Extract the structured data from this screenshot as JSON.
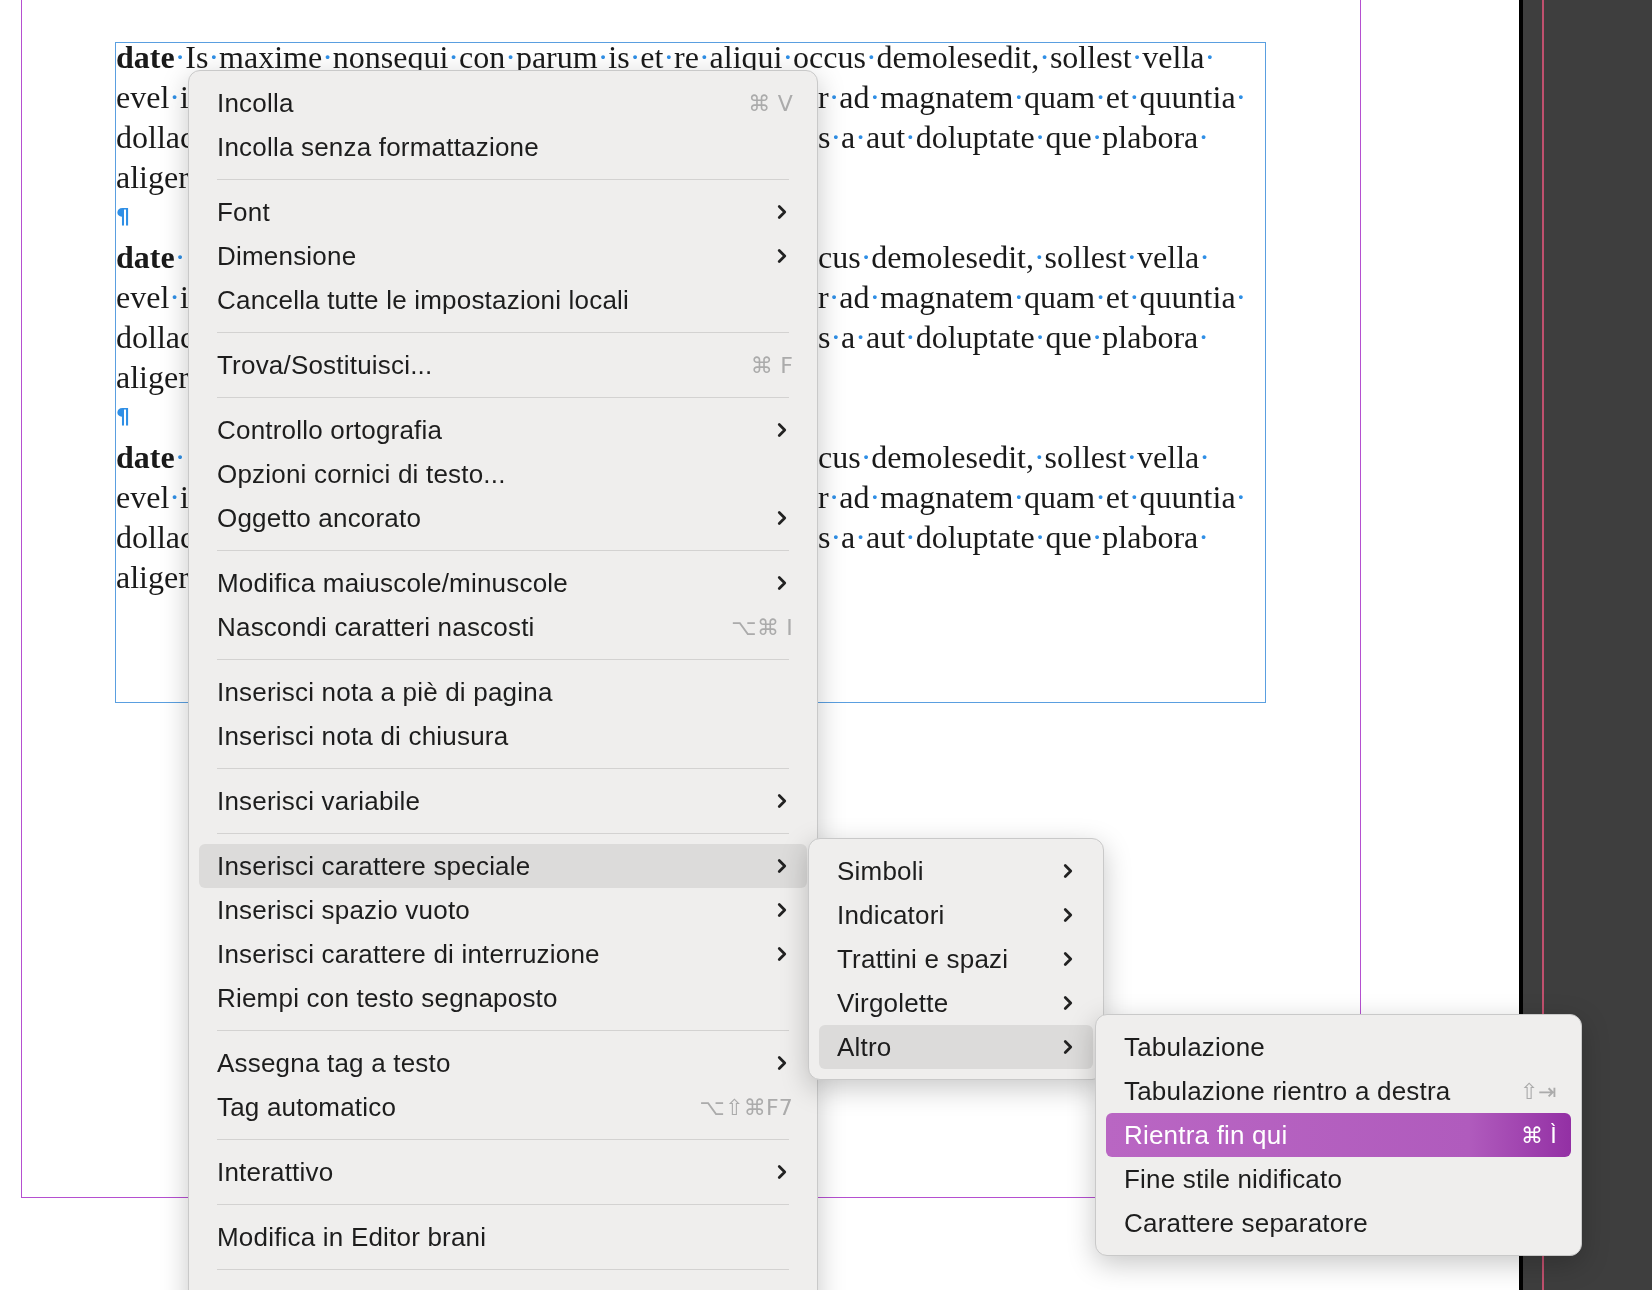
{
  "document": {
    "paragraphs": [
      {
        "lines": [
          {
            "text": "**date**·Is·maxime·nonsequi·con·parum·is·et·re·aliqui·occus·demolesedit,·sollest·vella·"
          },
          {
            "left": "evel·i",
            "right": "r·ad·magnatem·quam·et·quuntia·"
          },
          {
            "left": "dollac",
            "right": "s·a·aut·doluptate·que·plabora·"
          },
          {
            "left": "aliger"
          }
        ],
        "end_mark": "¶"
      },
      {
        "lines": [
          {
            "left": "**date**·",
            "right": "cus·demolesedit,·sollest·vella·"
          },
          {
            "left": "evel·i",
            "right": "r·ad·magnatem·quam·et·quuntia·"
          },
          {
            "left": "dollac",
            "right": "s·a·aut·doluptate·que·plabora·"
          },
          {
            "left": "aliger"
          }
        ],
        "end_mark": "¶"
      },
      {
        "lines": [
          {
            "left": "**date**·",
            "right": "cus·demolesedit,·sollest·vella·"
          },
          {
            "left": "evel·i",
            "right": "r·ad·magnatem·quam·et·quuntia·"
          },
          {
            "left": "dollac",
            "right": "s·a·aut·doluptate·que·plabora·"
          },
          {
            "left": "aliger"
          }
        ]
      }
    ]
  },
  "context_menu": {
    "items": [
      {
        "kind": "item",
        "label": "Incolla",
        "shortcut": "⌘ V",
        "has_submenu": false,
        "selected": false,
        "expanded": false
      },
      {
        "kind": "item",
        "label": "Incolla senza formattazione",
        "has_submenu": false,
        "selected": false,
        "expanded": false
      },
      {
        "kind": "separator"
      },
      {
        "kind": "item",
        "label": "Font",
        "has_submenu": true,
        "selected": false,
        "expanded": false
      },
      {
        "kind": "item",
        "label": "Dimensione",
        "has_submenu": true,
        "selected": false,
        "expanded": false
      },
      {
        "kind": "item",
        "label": "Cancella tutte le impostazioni locali",
        "has_submenu": false,
        "selected": false,
        "expanded": false
      },
      {
        "kind": "separator"
      },
      {
        "kind": "item",
        "label": "Trova/Sostituisci...",
        "shortcut": "⌘ F",
        "has_submenu": false,
        "selected": false,
        "expanded": false
      },
      {
        "kind": "separator"
      },
      {
        "kind": "item",
        "label": "Controllo ortografia",
        "has_submenu": true,
        "selected": false,
        "expanded": false
      },
      {
        "kind": "item",
        "label": "Opzioni cornici di testo...",
        "has_submenu": false,
        "selected": false,
        "expanded": false
      },
      {
        "kind": "item",
        "label": "Oggetto ancorato",
        "has_submenu": true,
        "selected": false,
        "expanded": false
      },
      {
        "kind": "separator"
      },
      {
        "kind": "item",
        "label": "Modifica maiuscole/minuscole",
        "has_submenu": true,
        "selected": false,
        "expanded": false
      },
      {
        "kind": "item",
        "label": "Nascondi caratteri nascosti",
        "shortcut": "⌥⌘ I",
        "has_submenu": false,
        "selected": false,
        "expanded": false
      },
      {
        "kind": "separator"
      },
      {
        "kind": "item",
        "label": "Inserisci nota a piè di pagina",
        "has_submenu": false,
        "selected": false,
        "expanded": false
      },
      {
        "kind": "item",
        "label": "Inserisci nota di chiusura",
        "has_submenu": false,
        "selected": false,
        "expanded": false
      },
      {
        "kind": "separator"
      },
      {
        "kind": "item",
        "label": "Inserisci variabile",
        "has_submenu": true,
        "selected": false,
        "expanded": false
      },
      {
        "kind": "separator"
      },
      {
        "kind": "item",
        "label": "Inserisci carattere speciale",
        "has_submenu": true,
        "selected": false,
        "expanded": true
      },
      {
        "kind": "item",
        "label": "Inserisci spazio vuoto",
        "has_submenu": true,
        "selected": false,
        "expanded": false
      },
      {
        "kind": "item",
        "label": "Inserisci carattere di interruzione",
        "has_submenu": true,
        "selected": false,
        "expanded": false
      },
      {
        "kind": "item",
        "label": "Riempi con testo segnaposto",
        "has_submenu": false,
        "selected": false,
        "expanded": false
      },
      {
        "kind": "separator"
      },
      {
        "kind": "item",
        "label": "Assegna tag a testo",
        "has_submenu": true,
        "selected": false,
        "expanded": false
      },
      {
        "kind": "item",
        "label": "Tag automatico",
        "shortcut": "⌥⇧⌘F7",
        "has_submenu": false,
        "selected": false,
        "expanded": false
      },
      {
        "kind": "separator"
      },
      {
        "kind": "item",
        "label": "Interattivo",
        "has_submenu": true,
        "selected": false,
        "expanded": false
      },
      {
        "kind": "separator"
      },
      {
        "kind": "item",
        "label": "Modifica in Editor brani",
        "has_submenu": false,
        "selected": false,
        "expanded": false
      },
      {
        "kind": "separator"
      }
    ]
  },
  "submenu": {
    "items": [
      {
        "kind": "item",
        "label": "Simboli",
        "has_submenu": true,
        "selected": false,
        "expanded": false
      },
      {
        "kind": "item",
        "label": "Indicatori",
        "has_submenu": true,
        "selected": false,
        "expanded": false
      },
      {
        "kind": "item",
        "label": "Trattini e spazi",
        "has_submenu": true,
        "selected": false,
        "expanded": false
      },
      {
        "kind": "item",
        "label": "Virgolette",
        "has_submenu": true,
        "selected": false,
        "expanded": false
      },
      {
        "kind": "item",
        "label": "Altro",
        "has_submenu": true,
        "selected": false,
        "expanded": true
      }
    ]
  },
  "submenu_2": {
    "items": [
      {
        "kind": "item",
        "label": "Tabulazione",
        "has_submenu": false,
        "selected": false,
        "expanded": false
      },
      {
        "kind": "item",
        "label": "Tabulazione rientro a destra",
        "shortcut": "⇧⇥",
        "has_submenu": false,
        "selected": false,
        "expanded": false
      },
      {
        "kind": "item",
        "label": "Rientra fin qui",
        "shortcut": "⌘ Ì",
        "has_submenu": false,
        "selected": true,
        "expanded": false
      },
      {
        "kind": "item",
        "label": "Fine stile nidificato",
        "has_submenu": false,
        "selected": false,
        "expanded": false
      },
      {
        "kind": "item",
        "label": "Carattere separatore",
        "has_submenu": false,
        "selected": false,
        "expanded": false
      }
    ]
  }
}
